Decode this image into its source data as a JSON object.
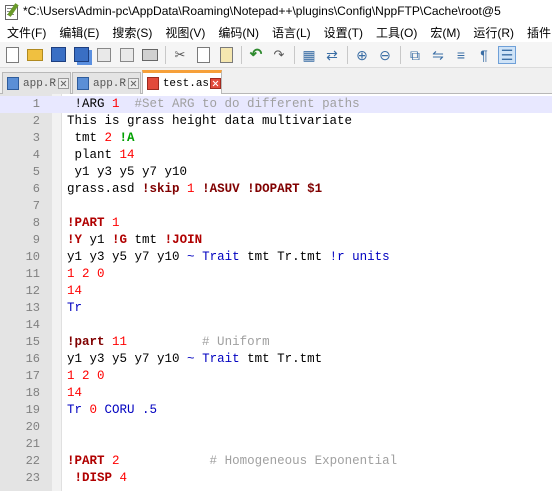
{
  "window": {
    "title": "*C:\\Users\\Admin-pc\\AppData\\Roaming\\Notepad++\\plugins\\Config\\NppFTP\\Cache\\root@5"
  },
  "menu": [
    {
      "label": "文件(F)"
    },
    {
      "label": "编辑(E)"
    },
    {
      "label": "搜索(S)"
    },
    {
      "label": "视图(V)"
    },
    {
      "label": "编码(N)"
    },
    {
      "label": "语言(L)"
    },
    {
      "label": "设置(T)"
    },
    {
      "label": "工具(O)"
    },
    {
      "label": "宏(M)"
    },
    {
      "label": "运行(R)"
    },
    {
      "label": "插件"
    }
  ],
  "toolbar": {
    "icons": [
      "new-file-icon",
      "open-folder-icon",
      "save-icon",
      "save-all-icon",
      "close-icon",
      "close-all-icon",
      "print-icon",
      "cut-icon",
      "copy-icon",
      "paste-icon",
      "undo-icon",
      "redo-icon",
      "find-icon",
      "replace-icon",
      "zoom-in-icon",
      "zoom-out-icon",
      "sync-v-icon",
      "sync-h-icon",
      "wrap-icon",
      "show-all-chars-icon",
      "indent-guide-icon"
    ]
  },
  "tabs": [
    {
      "label": "app.R",
      "active": false
    },
    {
      "label": "app.R",
      "active": false
    },
    {
      "label": "test.as",
      "active": true
    }
  ],
  "colors": {
    "accent_tab": "#f6a03a",
    "current_line": "#e8e8ff",
    "gutter": "#e4e4e4"
  },
  "editor": {
    "current_line": 1,
    "lines": [
      {
        "n": "1",
        "tokens": [
          {
            "t": " !ARG ",
            "c": "c-default"
          },
          {
            "t": "1",
            "c": "c-num"
          },
          {
            "t": "  #Set ARG to do different paths",
            "c": "c-comment"
          }
        ]
      },
      {
        "n": "2",
        "tokens": [
          {
            "t": "This is grass height data multivariate",
            "c": "c-default"
          }
        ]
      },
      {
        "n": "3",
        "tokens": [
          {
            "t": " tmt ",
            "c": "c-default"
          },
          {
            "t": "2",
            "c": "c-num"
          },
          {
            "t": " ",
            "c": "c-default"
          },
          {
            "t": "!A",
            "c": "c-green"
          }
        ]
      },
      {
        "n": "4",
        "tokens": [
          {
            "t": " plant ",
            "c": "c-default"
          },
          {
            "t": "14",
            "c": "c-num"
          }
        ]
      },
      {
        "n": "5",
        "tokens": [
          {
            "t": " y1 y3 y5 y7 y10",
            "c": "c-default"
          }
        ]
      },
      {
        "n": "6",
        "tokens": [
          {
            "t": "grass.asd ",
            "c": "c-default"
          },
          {
            "t": "!skip",
            "c": "c-darkred"
          },
          {
            "t": " ",
            "c": "c-default"
          },
          {
            "t": "1",
            "c": "c-num"
          },
          {
            "t": " ",
            "c": "c-default"
          },
          {
            "t": "!ASUV !DOPART $1",
            "c": "c-darkred"
          }
        ]
      },
      {
        "n": "7",
        "tokens": []
      },
      {
        "n": "8",
        "tokens": [
          {
            "t": "!PART",
            "c": "c-kw"
          },
          {
            "t": " ",
            "c": "c-default"
          },
          {
            "t": "1",
            "c": "c-num"
          }
        ]
      },
      {
        "n": "9",
        "tokens": [
          {
            "t": "!Y",
            "c": "c-kw"
          },
          {
            "t": " y1 ",
            "c": "c-default"
          },
          {
            "t": "!G",
            "c": "c-kw"
          },
          {
            "t": " tmt ",
            "c": "c-default"
          },
          {
            "t": "!JOIN",
            "c": "c-kw"
          }
        ]
      },
      {
        "n": "10",
        "tokens": [
          {
            "t": "y1 y3 y5 y7 y10 ",
            "c": "c-default"
          },
          {
            "t": "~",
            "c": "c-blue"
          },
          {
            "t": " ",
            "c": "c-default"
          },
          {
            "t": "Trait",
            "c": "c-blue"
          },
          {
            "t": " tmt Tr.tmt ",
            "c": "c-default"
          },
          {
            "t": "!r units",
            "c": "c-blue"
          }
        ]
      },
      {
        "n": "11",
        "tokens": [
          {
            "t": "1 2 0",
            "c": "c-num"
          }
        ]
      },
      {
        "n": "12",
        "tokens": [
          {
            "t": "14",
            "c": "c-num"
          }
        ]
      },
      {
        "n": "13",
        "tokens": [
          {
            "t": "Tr",
            "c": "c-blue"
          }
        ]
      },
      {
        "n": "14",
        "tokens": []
      },
      {
        "n": "15",
        "tokens": [
          {
            "t": "!part",
            "c": "c-darkred"
          },
          {
            "t": " ",
            "c": "c-default"
          },
          {
            "t": "11",
            "c": "c-num"
          },
          {
            "t": "          # Uniform",
            "c": "c-comment"
          }
        ]
      },
      {
        "n": "16",
        "tokens": [
          {
            "t": "y1 y3 y5 y7 y10 ",
            "c": "c-default"
          },
          {
            "t": "~",
            "c": "c-blue"
          },
          {
            "t": " ",
            "c": "c-default"
          },
          {
            "t": "Trait",
            "c": "c-blue"
          },
          {
            "t": " tmt Tr.tmt",
            "c": "c-default"
          }
        ]
      },
      {
        "n": "17",
        "tokens": [
          {
            "t": "1 2 0",
            "c": "c-num"
          }
        ]
      },
      {
        "n": "18",
        "tokens": [
          {
            "t": "14",
            "c": "c-num"
          }
        ]
      },
      {
        "n": "19",
        "tokens": [
          {
            "t": "Tr ",
            "c": "c-blue"
          },
          {
            "t": "0",
            "c": "c-num"
          },
          {
            "t": " CORU .5",
            "c": "c-blue"
          }
        ]
      },
      {
        "n": "20",
        "tokens": []
      },
      {
        "n": "21",
        "tokens": []
      },
      {
        "n": "22",
        "tokens": [
          {
            "t": "!PART",
            "c": "c-kw"
          },
          {
            "t": " ",
            "c": "c-default"
          },
          {
            "t": "2",
            "c": "c-num"
          },
          {
            "t": "            # Homogeneous Exponential",
            "c": "c-comment"
          }
        ]
      },
      {
        "n": "23",
        "tokens": [
          {
            "t": " !DISP",
            "c": "c-kw"
          },
          {
            "t": " ",
            "c": "c-default"
          },
          {
            "t": "4",
            "c": "c-num"
          }
        ]
      }
    ]
  }
}
